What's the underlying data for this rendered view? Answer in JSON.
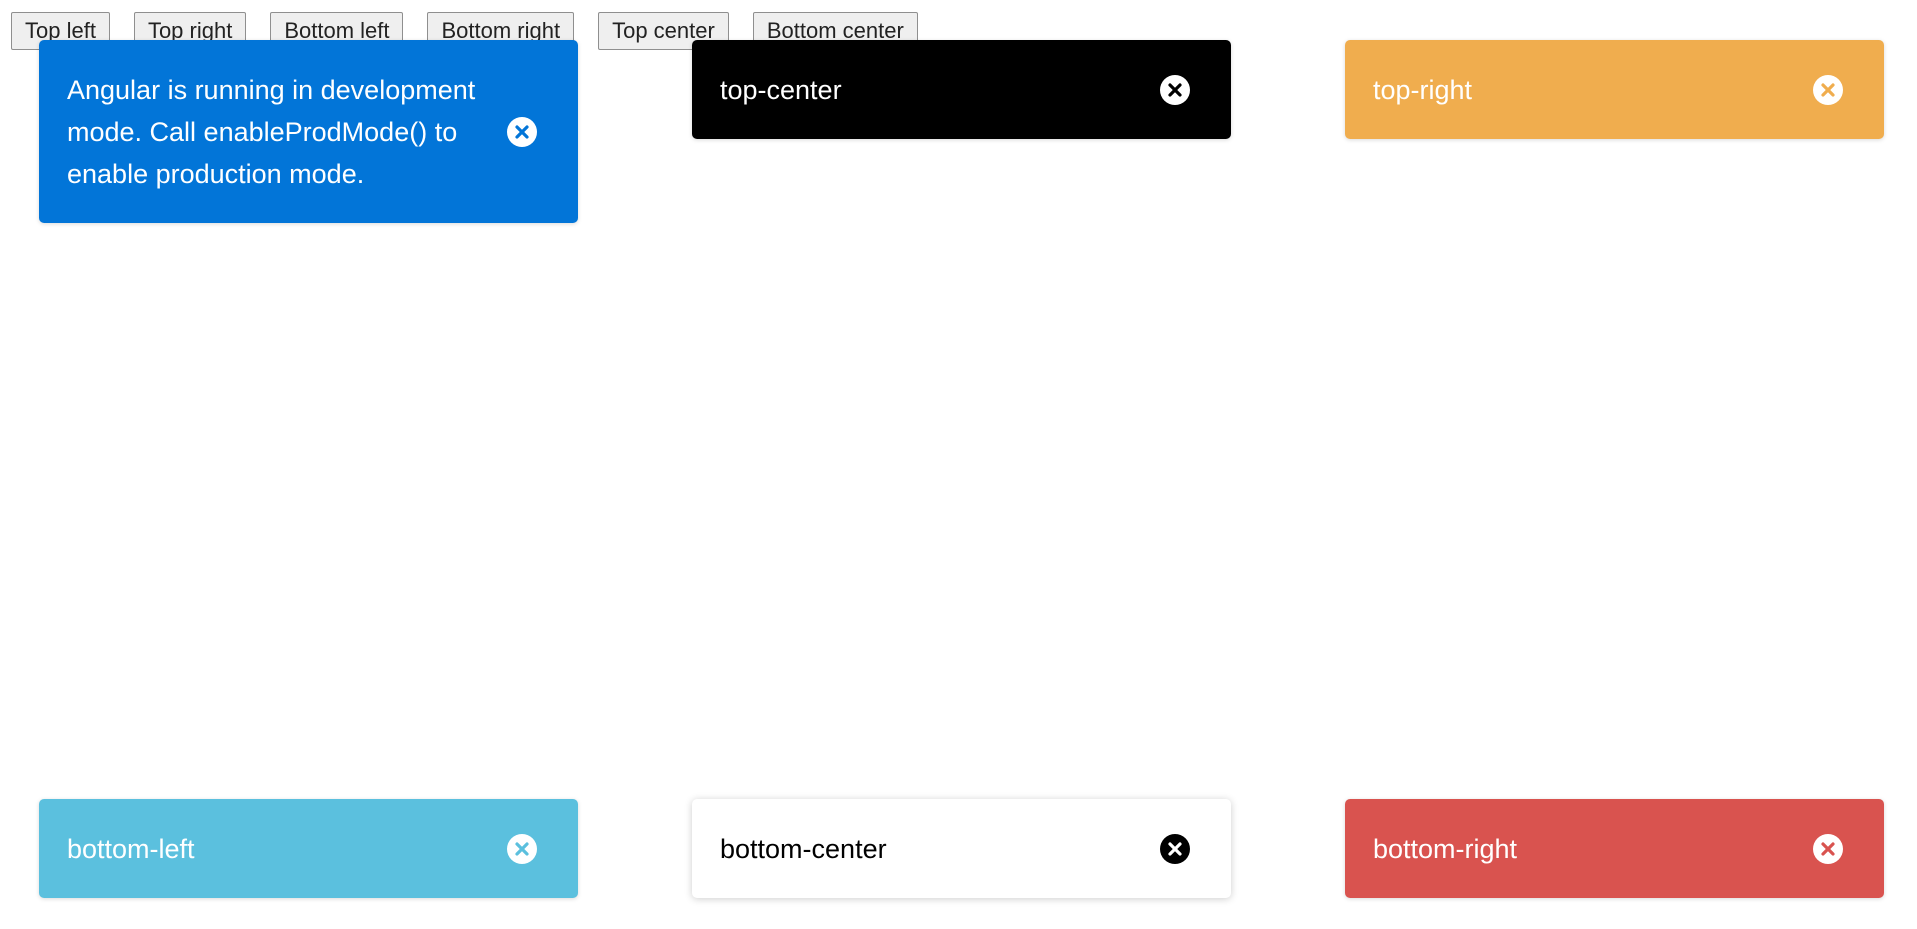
{
  "buttons": [
    {
      "label": "Top left"
    },
    {
      "label": "Top right"
    },
    {
      "label": "Bottom left"
    },
    {
      "label": "Bottom right"
    },
    {
      "label": "Top center"
    },
    {
      "label": "Bottom center"
    }
  ],
  "toasts": {
    "dev_mode": {
      "message": "Angular is running in development mode. Call enableProdMode() to enable production mode.",
      "color": "#0275d8",
      "icon": "close-circle-icon"
    },
    "top_center": {
      "message": "top-center",
      "color": "#000000",
      "icon": "close-circle-icon"
    },
    "top_right": {
      "message": "top-right",
      "color": "#f0ad4e",
      "icon": "close-circle-icon"
    },
    "bottom_left": {
      "message": "bottom-left",
      "color": "#5bc0de",
      "icon": "close-circle-icon"
    },
    "bottom_center": {
      "message": "bottom-center",
      "color": "#ffffff",
      "icon": "close-circle-icon"
    },
    "bottom_right": {
      "message": "bottom-right",
      "color": "#d9534f",
      "icon": "close-circle-icon"
    }
  }
}
